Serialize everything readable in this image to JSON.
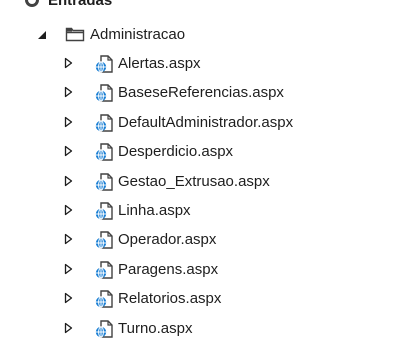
{
  "tree": {
    "parent": {
      "label": "Entradas",
      "expander": "partial-visible",
      "icon": "globe-folder-icon"
    },
    "folder": {
      "label": "Administracao",
      "expanded": true,
      "expander_icon": "expanded-triangle-icon",
      "icon": "folder-icon"
    },
    "items": [
      {
        "label": "Alertas.aspx",
        "icon": "aspx-file-icon",
        "expander_icon": "collapsed-triangle-icon"
      },
      {
        "label": "BaseseReferencias.aspx",
        "icon": "aspx-file-icon",
        "expander_icon": "collapsed-triangle-icon"
      },
      {
        "label": "DefaultAdministrador.aspx",
        "icon": "aspx-file-icon",
        "expander_icon": "collapsed-triangle-icon"
      },
      {
        "label": "Desperdicio.aspx",
        "icon": "aspx-file-icon",
        "expander_icon": "collapsed-triangle-icon"
      },
      {
        "label": "Gestao_Extrusao.aspx",
        "icon": "aspx-file-icon",
        "expander_icon": "collapsed-triangle-icon"
      },
      {
        "label": "Linha.aspx",
        "icon": "aspx-file-icon",
        "expander_icon": "collapsed-triangle-icon"
      },
      {
        "label": "Operador.aspx",
        "icon": "aspx-file-icon",
        "expander_icon": "collapsed-triangle-icon"
      },
      {
        "label": "Paragens.aspx",
        "icon": "aspx-file-icon",
        "expander_icon": "collapsed-triangle-icon"
      },
      {
        "label": "Relatorios.aspx",
        "icon": "aspx-file-icon",
        "expander_icon": "collapsed-triangle-icon"
      },
      {
        "label": "Turno.aspx",
        "icon": "aspx-file-icon",
        "expander_icon": "collapsed-triangle-icon"
      }
    ],
    "colors": {
      "text": "#1e1e1e",
      "globe_blue": "#1a7fd4",
      "file_dark": "#424242",
      "folder_stroke": "#424242"
    }
  }
}
